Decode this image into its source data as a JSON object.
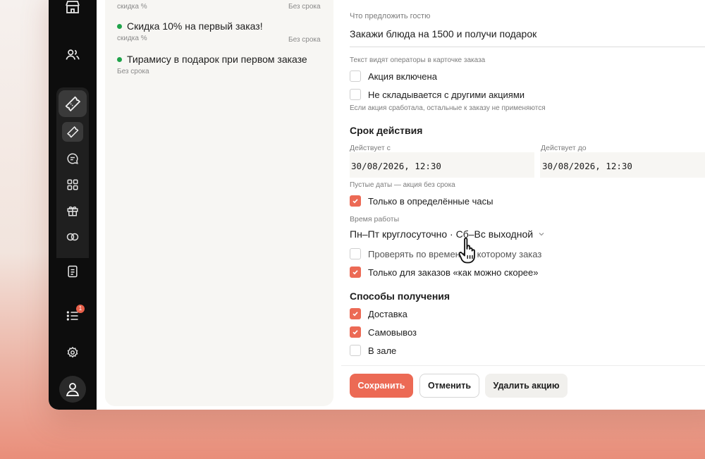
{
  "sidebar": {
    "icons": [
      "store-icon",
      "users-icon",
      "promo-ticket-icon",
      "ticket-icon",
      "chat-icon",
      "grid-icon",
      "gift-icon",
      "toggle-icon",
      "document-icon",
      "list-icon",
      "gear-icon",
      "user-icon"
    ],
    "list_badge": "1"
  },
  "promos": [
    {
      "title": "",
      "subtitle": "скидка %",
      "expiry": "Без срока"
    },
    {
      "title": "Скидка 10% на первый заказ!",
      "subtitle": "скидка %",
      "expiry": "Без срока"
    },
    {
      "title": "Тирамису в подарок при первом заказе",
      "subtitle": "Без срока",
      "expiry": ""
    }
  ],
  "form": {
    "offer_label": "Что предложить гостю",
    "offer_value": "Закажи блюда на 1500 и получи подарок",
    "operators_hint": "Текст видят операторы в карточке заказа",
    "enabled_label": "Акция включена",
    "no_combine_label": "Не складывается с другими акциями",
    "no_combine_hint": "Если акция сработала, остальные к заказу не применяются",
    "validity_title": "Срок действия",
    "from_label": "Действует с",
    "from_value": "30/08/2026, 12:30",
    "to_label": "Действует до",
    "to_value": "30/08/2026, 12:30",
    "empty_dates_hint": "Пустые даты — акция без срока",
    "certain_hours_label": "Только в определённые часы",
    "work_time_label": "Время работы",
    "work_time_value": "Пн–Пт круглосуточно · Сб–Вс выходной",
    "check_time_label": "Проверять по времени, к которому заказ",
    "asap_label": "Только для заказов «как можно скорее»",
    "delivery_title": "Способы получения",
    "delivery_label": "Доставка",
    "pickup_label": "Самовывоз",
    "hall_label": "В зале",
    "checkboxes": {
      "enabled": false,
      "no_combine": false,
      "certain_hours": true,
      "check_time": false,
      "asap": true,
      "delivery": true,
      "pickup": true,
      "hall": false
    }
  },
  "buttons": {
    "save": "Сохранить",
    "cancel": "Отменить",
    "delete": "Удалить акцию"
  },
  "colors": {
    "accent": "#ec6a55",
    "active_dot": "#1fa34a",
    "rail": "#0d0d0d"
  }
}
